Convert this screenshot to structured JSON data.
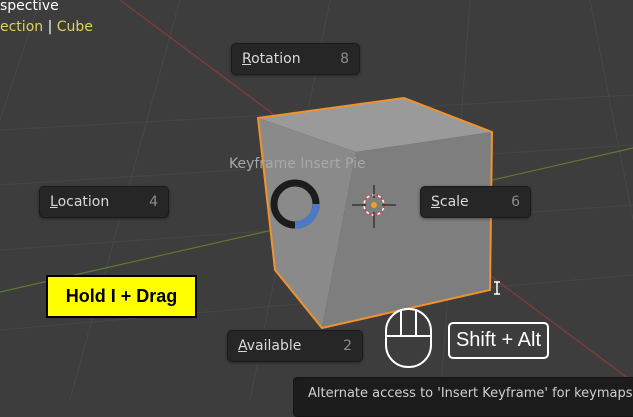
{
  "viewport": {
    "view_name": "spective",
    "collection": "ection",
    "separator": "|",
    "object": "Cube"
  },
  "pie_menu": {
    "title": "Keyframe Insert Pie",
    "items": {
      "rotation": {
        "label": "Rotation",
        "shortcut": "8"
      },
      "location": {
        "label": "Location",
        "shortcut": "4"
      },
      "scale": {
        "label": "Scale",
        "shortcut": "6"
      },
      "available": {
        "label": "Available",
        "shortcut": "2"
      }
    }
  },
  "overlays": {
    "hold_label": "Hold I + Drag",
    "modifier_keys": "Shift + Alt",
    "mouse_icon": "mouse-icon"
  },
  "tooltip": {
    "text": "Alternate access to 'Insert Keyframe' for keymaps"
  },
  "colors": {
    "viewport_bg": "#3d3d3d",
    "selection_outline": "#f0922e",
    "pie_ring_active": "#4a7ac8",
    "hold_box_bg": "#ffff00",
    "collection_text": "#e0d060"
  }
}
